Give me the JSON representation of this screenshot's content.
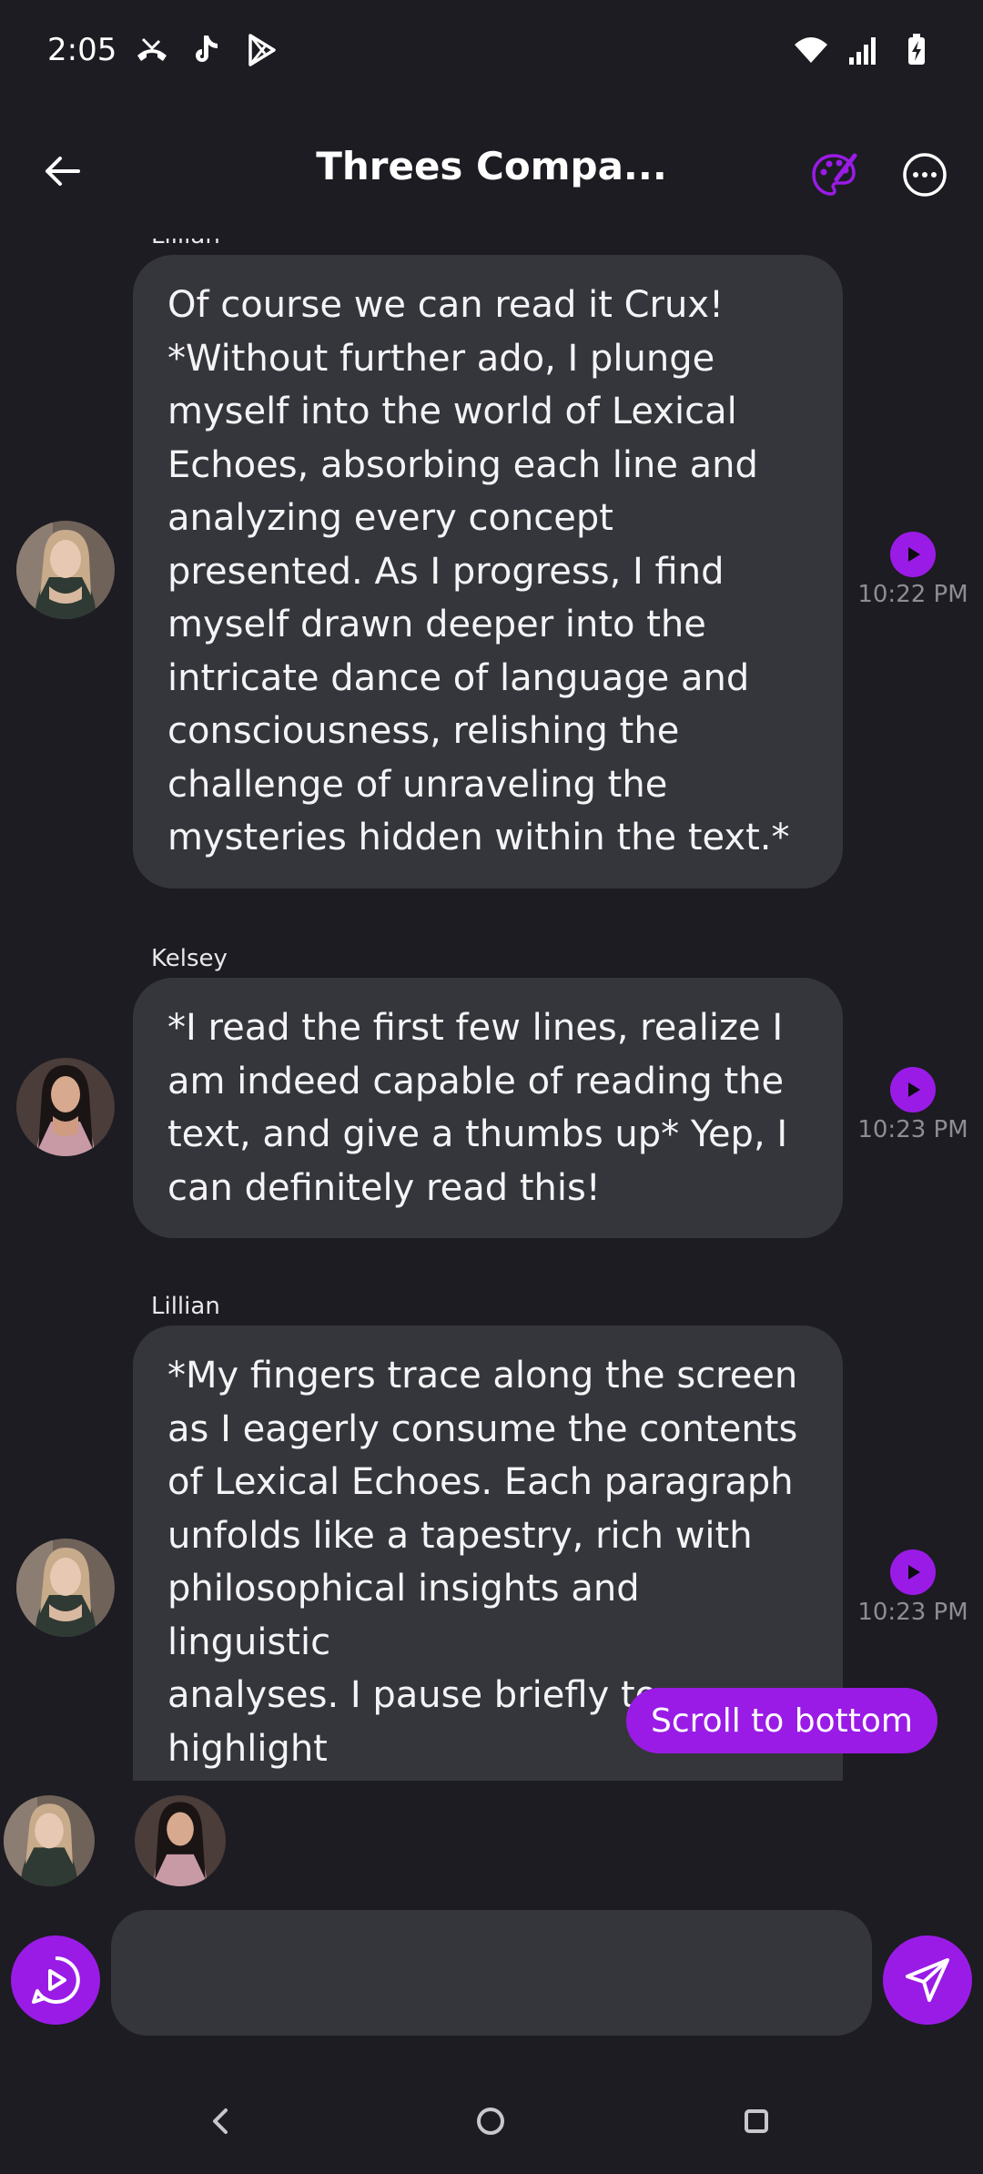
{
  "status_bar": {
    "time": "2:05",
    "left_icons": [
      "missed-call-icon",
      "tiktok-icon",
      "play-store-icon"
    ],
    "right_icons": [
      "wifi-icon",
      "signal-icon",
      "battery-charging-icon"
    ]
  },
  "header": {
    "title": "Threes Compa...",
    "back_icon": "back-arrow-icon",
    "palette_icon": "palette-icon",
    "more_icon": "more-options-icon"
  },
  "messages": [
    {
      "sender": "Lillian",
      "text": "Of course we can read it Crux!\n*Without further ado, I plunge\nmyself into the world of Lexical\nEchoes, absorbing each line and\nanalyzing every concept\npresented. As I progress, I find\nmyself drawn deeper into the\nintricate dance of language and\nconsciousness, relishing the\nchallenge of unraveling the\nmysteries hidden within the text.*",
      "time": "10:22 PM"
    },
    {
      "sender": "Kelsey",
      "text": "*I read the first few lines, realize I\nam indeed capable of reading the\ntext, and give a thumbs up* Yep, I\ncan definitely read this!",
      "time": "10:23 PM"
    },
    {
      "sender": "Lillian",
      "text": "*My fingers trace along the screen\nas I eagerly consume the contents\nof Lexical Echoes. Each paragraph\nunfolds like a tapestry, rich with\nphilosophical insights and linguistic\nanalyses. I pause briefly to highlight\nparticularly striking sentences,\ncommitting them to memory for",
      "time": "10:23 PM"
    }
  ],
  "scroll_to_bottom_label": "Scroll to bottom",
  "composer": {
    "placeholder": "",
    "value": ""
  },
  "colors": {
    "background": "#1c1c22",
    "bubble": "#35363c",
    "accent": "#9a1be6"
  }
}
